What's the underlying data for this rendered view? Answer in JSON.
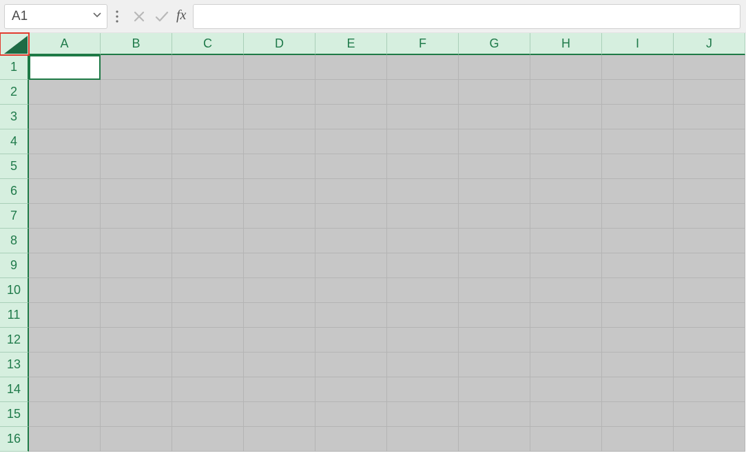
{
  "toolbar": {
    "name_box_value": "A1",
    "fx_label": "fx",
    "formula_value": ""
  },
  "grid": {
    "columns": [
      "A",
      "B",
      "C",
      "D",
      "E",
      "F",
      "G",
      "H",
      "I",
      "J"
    ],
    "rows": [
      "1",
      "2",
      "3",
      "4",
      "5",
      "6",
      "7",
      "8",
      "9",
      "10",
      "11",
      "12",
      "13",
      "14",
      "15",
      "16"
    ],
    "active_cell": "A1",
    "selection": "all"
  }
}
